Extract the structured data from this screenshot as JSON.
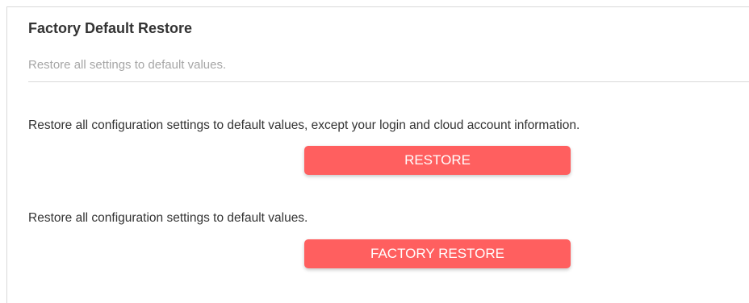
{
  "section": {
    "title": "Factory Default Restore",
    "subtitle": "Restore all settings to default values."
  },
  "restore": {
    "description": "Restore all configuration settings to default values, except your login and cloud account information.",
    "button_label": "RESTORE"
  },
  "factory_restore": {
    "description": "Restore all configuration settings to default values.",
    "button_label": "FACTORY RESTORE"
  },
  "colors": {
    "button_bg": "#ff5f5f",
    "title_text": "#333333",
    "subtitle_text": "#a6a6a6"
  }
}
